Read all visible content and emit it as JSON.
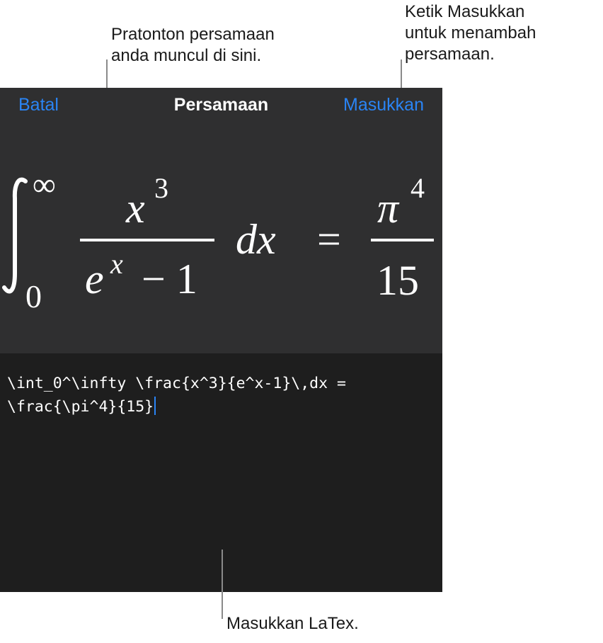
{
  "callouts": {
    "preview": {
      "lines": [
        "Pratonton persamaan",
        "anda muncul di sini."
      ]
    },
    "insert": {
      "lines": [
        "Ketik Masukkan",
        "untuk menambah",
        "persamaan."
      ]
    },
    "latex": {
      "lines": [
        "Masukkan LaTex."
      ]
    }
  },
  "dialog": {
    "cancel_label": "Batal",
    "title": "Persamaan",
    "insert_label": "Masukkan"
  },
  "equation_preview": {
    "int_upper": "∞",
    "int_lower": "0",
    "numerator_base": "x",
    "numerator_exp": "3",
    "denominator_base": "e",
    "denominator_exp": "x",
    "denominator_rest": "− 1",
    "differential": "dx",
    "equals": "=",
    "rhs_num_base": "π",
    "rhs_num_exp": "4",
    "rhs_den": "15"
  },
  "editor": {
    "latex_lines": [
      "\\int_0^\\infty \\frac{x^3}{e^x-1}\\,dx =",
      "\\frac{\\pi^4}{15}"
    ]
  },
  "colors": {
    "accent": "#2a84f4",
    "header_bg": "#2f2f30",
    "editor_bg": "#1e1e1e"
  }
}
